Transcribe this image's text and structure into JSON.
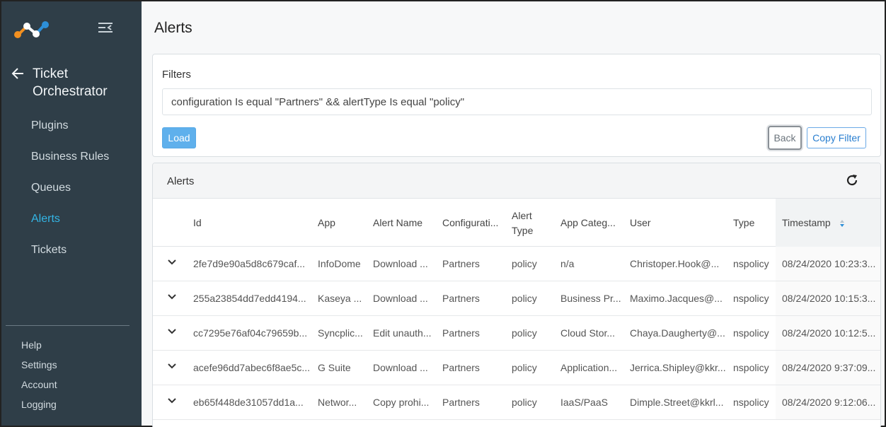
{
  "sidebar": {
    "section_title_line1": "Ticket",
    "section_title_line2": "Orchestrator",
    "items": [
      {
        "label": "Plugins"
      },
      {
        "label": "Business Rules"
      },
      {
        "label": "Queues"
      },
      {
        "label": "Alerts"
      },
      {
        "label": "Tickets"
      }
    ],
    "bottom": [
      {
        "label": "Help"
      },
      {
        "label": "Settings"
      },
      {
        "label": "Account"
      },
      {
        "label": "Logging"
      }
    ],
    "active_item": "Alerts",
    "active_color": "#33b5e5"
  },
  "page": {
    "title": "Alerts"
  },
  "filters": {
    "label": "Filters",
    "value": "configuration Is equal \"Partners\" && alertType Is equal \"policy\"",
    "load_label": "Load",
    "back_label": "Back",
    "copy_label": "Copy Filter"
  },
  "alerts": {
    "title": "Alerts",
    "columns": {
      "id": "Id",
      "app": "App",
      "alert_name": "Alert Name",
      "configuration": "Configurati...",
      "alert_type_1": "Alert",
      "alert_type_2": "Type",
      "app_category": "App Categ...",
      "user": "User",
      "type": "Type",
      "timestamp": "Timestamp"
    },
    "sorted_column": "Timestamp",
    "rows": [
      {
        "id": "2fe7d9e90a5d8c679caf...",
        "app": "InfoDome",
        "alert_name": "Download ...",
        "configuration": "Partners",
        "alert_type": "policy",
        "app_category": "n/a",
        "user": "Christoper.Hook@...",
        "type": "nspolicy",
        "timestamp": "08/24/2020 10:23:3..."
      },
      {
        "id": "255a23854dd7edd4194...",
        "app": "Kaseya ...",
        "alert_name": "Download ...",
        "configuration": "Partners",
        "alert_type": "policy",
        "app_category": "Business Pr...",
        "user": "Maximo.Jacques@...",
        "type": "nspolicy",
        "timestamp": "08/24/2020 10:15:3..."
      },
      {
        "id": "cc7295e76af04c79659b...",
        "app": "Syncplic...",
        "alert_name": "Edit unauth...",
        "configuration": "Partners",
        "alert_type": "policy",
        "app_category": "Cloud Stor...",
        "user": "Chaya.Daugherty@...",
        "type": "nspolicy",
        "timestamp": "08/24/2020 10:12:5..."
      },
      {
        "id": "acefe96dd7abec6f8ae5c...",
        "app": "G Suite",
        "alert_name": "Download ...",
        "configuration": "Partners",
        "alert_type": "policy",
        "app_category": "Application...",
        "user": "Jerrica.Shipley@kkr...",
        "type": "nspolicy",
        "timestamp": "08/24/2020 9:37:09..."
      },
      {
        "id": "eb65f448de31057dd1a...",
        "app": "Networ...",
        "alert_name": "Copy prohi...",
        "configuration": "Partners",
        "alert_type": "policy",
        "app_category": "IaaS/PaaS",
        "user": "Dimple.Street@kkrl...",
        "type": "nspolicy",
        "timestamp": "08/24/2020 9:12:06..."
      }
    ]
  }
}
